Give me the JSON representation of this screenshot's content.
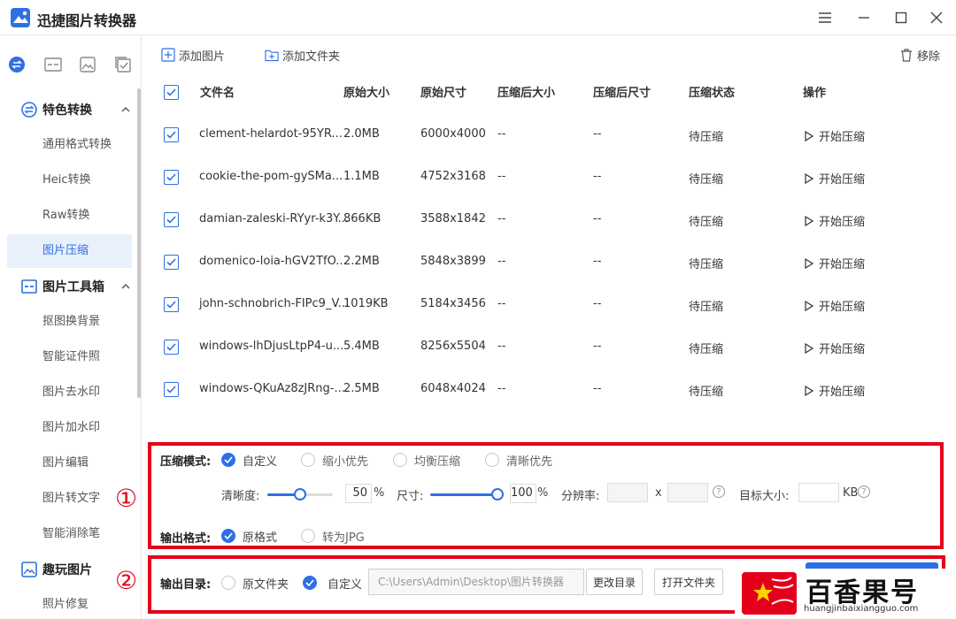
{
  "app": {
    "title": "迅捷图片转换器"
  },
  "sidebar": {
    "section1": {
      "label": "特色转换",
      "items": [
        "通用格式转换",
        "Heic转换",
        "Raw转换",
        "图片压缩"
      ]
    },
    "section2": {
      "label": "图片工具箱",
      "items": [
        "抠图换背景",
        "智能证件照",
        "图片去水印",
        "图片加水印",
        "图片编辑",
        "图片转文字",
        "智能消除笔"
      ]
    },
    "section3": {
      "label": "趣玩图片",
      "items": [
        "照片修复"
      ]
    },
    "active_item": "图片压缩"
  },
  "toolbar": {
    "add_image": "添加图片",
    "add_folder": "添加文件夹",
    "remove": "移除"
  },
  "table": {
    "headers": [
      "文件名",
      "原始大小",
      "原始尺寸",
      "压缩后大小",
      "压缩后尺寸",
      "压缩状态",
      "操作"
    ],
    "rows": [
      {
        "name": "clement-helardot-95YR...",
        "size": "2.0MB",
        "dims": "6000x4000",
        "csize": "--",
        "cdims": "--",
        "status": "待压缩",
        "action": "开始压缩"
      },
      {
        "name": "cookie-the-pom-gySMa...",
        "size": "1.1MB",
        "dims": "4752x3168",
        "csize": "--",
        "cdims": "--",
        "status": "待压缩",
        "action": "开始压缩"
      },
      {
        "name": "damian-zaleski-RYyr-k3Y...",
        "size": "866KB",
        "dims": "3588x1842",
        "csize": "--",
        "cdims": "--",
        "status": "待压缩",
        "action": "开始压缩"
      },
      {
        "name": "domenico-loia-hGV2TfO...",
        "size": "2.2MB",
        "dims": "5848x3899",
        "csize": "--",
        "cdims": "--",
        "status": "待压缩",
        "action": "开始压缩"
      },
      {
        "name": "john-schnobrich-FIPc9_V...",
        "size": "1019KB",
        "dims": "5184x3456",
        "csize": "--",
        "cdims": "--",
        "status": "待压缩",
        "action": "开始压缩"
      },
      {
        "name": "windows-lhDjusLtpP4-u...",
        "size": "5.4MB",
        "dims": "8256x5504",
        "csize": "--",
        "cdims": "--",
        "status": "待压缩",
        "action": "开始压缩"
      },
      {
        "name": "windows-QKuAz8zJRng-...",
        "size": "2.5MB",
        "dims": "6048x4024",
        "csize": "--",
        "cdims": "--",
        "status": "待压缩",
        "action": "开始压缩"
      }
    ]
  },
  "settings": {
    "mode_label": "压缩模式:",
    "modes": [
      "自定义",
      "缩小优先",
      "均衡压缩",
      "清晰优先"
    ],
    "selected_mode": "自定义",
    "clarity_label": "清晰度:",
    "clarity_value": "50",
    "clarity_percent": 0.5,
    "size_label": "尺寸:",
    "size_value": "100",
    "size_percent": 1.0,
    "percent_sign": "%",
    "resolution_label": "分辨率:",
    "resolution_x": "x",
    "target_label": "目标大小:",
    "target_unit": "KB",
    "format_label": "输出格式:",
    "formats": [
      "原格式",
      "转为JPG"
    ],
    "selected_format": "原格式",
    "output_label": "输出目录:",
    "output_options": [
      "原文件夹",
      "自定义"
    ],
    "selected_output": "自定义",
    "output_path": "C:\\Users\\Admin\\Desktop\\图片转换器",
    "change_dir": "更改目录",
    "open_folder": "打开文件夹",
    "marker1": "①",
    "marker2": "②"
  },
  "watermark": {
    "name": "百香果号",
    "url": "huangjinbaixiangguo.com"
  },
  "colors": {
    "accent": "#2f6fe4",
    "highlight": "#e4001b"
  }
}
